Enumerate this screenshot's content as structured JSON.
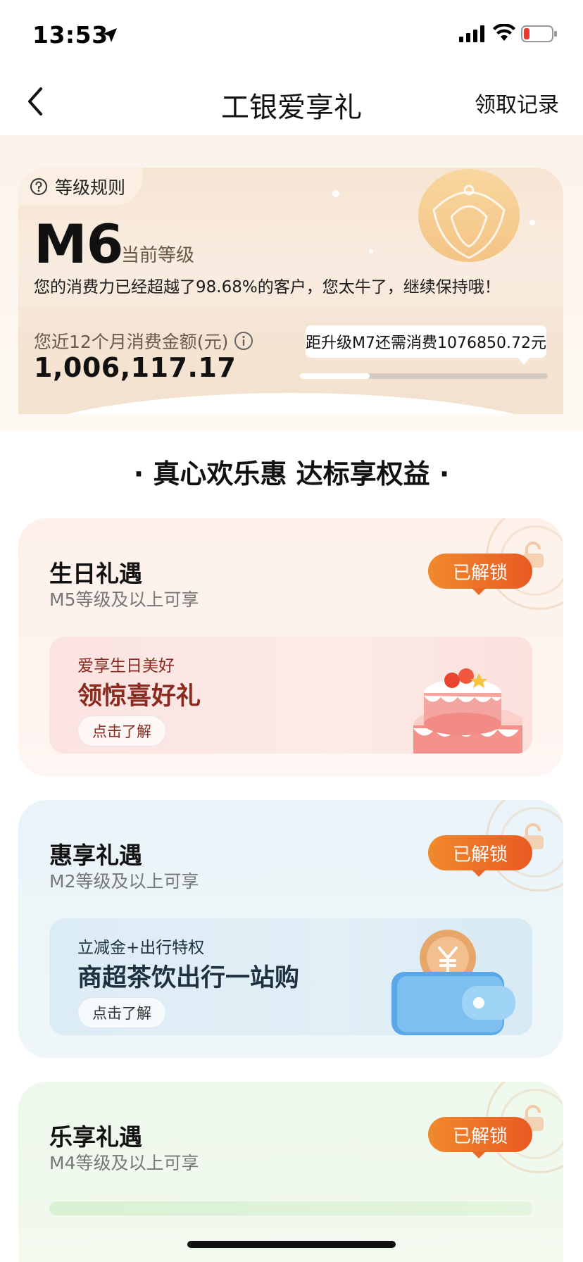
{
  "status_bar": {
    "time": "13:53"
  },
  "nav": {
    "title": "工银爱享礼",
    "right_link": "领取记录"
  },
  "level": {
    "rules_label": "等级规则",
    "current_level": "M6",
    "current_level_label": "当前等级",
    "description": "您的消费力已经超越了98.68%的客户，您太牛了，继续保持哦！",
    "spend_label": "您近12个月消费金额(元)",
    "spend_value": "1,006,117.17",
    "upgrade_hint": "距升级M7还需消费1076850.72元",
    "progress_fraction": 0.28
  },
  "section_title": "· 真心欢乐惠 达标享权益 ·",
  "benefits": [
    {
      "title": "生日礼遇",
      "subtitle": "M5等级及以上可享",
      "badge": "已解锁",
      "eyebrow": "爱享生日美好",
      "headline": "领惊喜好礼",
      "button": "点击了解"
    },
    {
      "title": "惠享礼遇",
      "subtitle": "M2等级及以上可享",
      "badge": "已解锁",
      "eyebrow": "立减金+出行特权",
      "headline": "商超茶饮出行一站购",
      "button": "点击了解"
    },
    {
      "title": "乐享礼遇",
      "subtitle": "M4等级及以上可享",
      "badge": "已解锁"
    }
  ],
  "colors": {
    "badge_gradient_start": "#f08a2c",
    "badge_gradient_end": "#e85a22",
    "level_card_bg": "#f7e5d4",
    "birthday_card_bg": "#fdf1ea",
    "discount_card_bg": "#eaf4f8",
    "leisure_card_bg": "#eef8ec"
  },
  "icons": {
    "back": "chevron-left-icon",
    "rules": "question-circle-icon",
    "info": "info-circle-icon",
    "lock": "lock-icon"
  }
}
